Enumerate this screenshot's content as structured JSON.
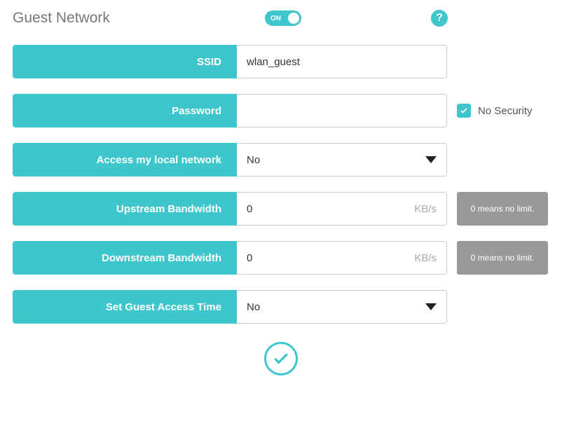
{
  "header": {
    "title": "Guest Network",
    "toggle_state": "ON"
  },
  "fields": {
    "ssid": {
      "label": "SSID",
      "value": "wlan_guest"
    },
    "password": {
      "label": "Password",
      "value": "",
      "no_security_label": "No Security"
    },
    "access_local": {
      "label": "Access my local network",
      "value": "No"
    },
    "upstream": {
      "label": "Upstream Bandwidth",
      "value": "0",
      "unit": "KB/s",
      "hint": "0 means no limit."
    },
    "downstream": {
      "label": "Downstream Bandwidth",
      "value": "0",
      "unit": "KB/s",
      "hint": "0 means no limit."
    },
    "guest_time": {
      "label": "Set Guest Access Time",
      "value": "No"
    }
  }
}
